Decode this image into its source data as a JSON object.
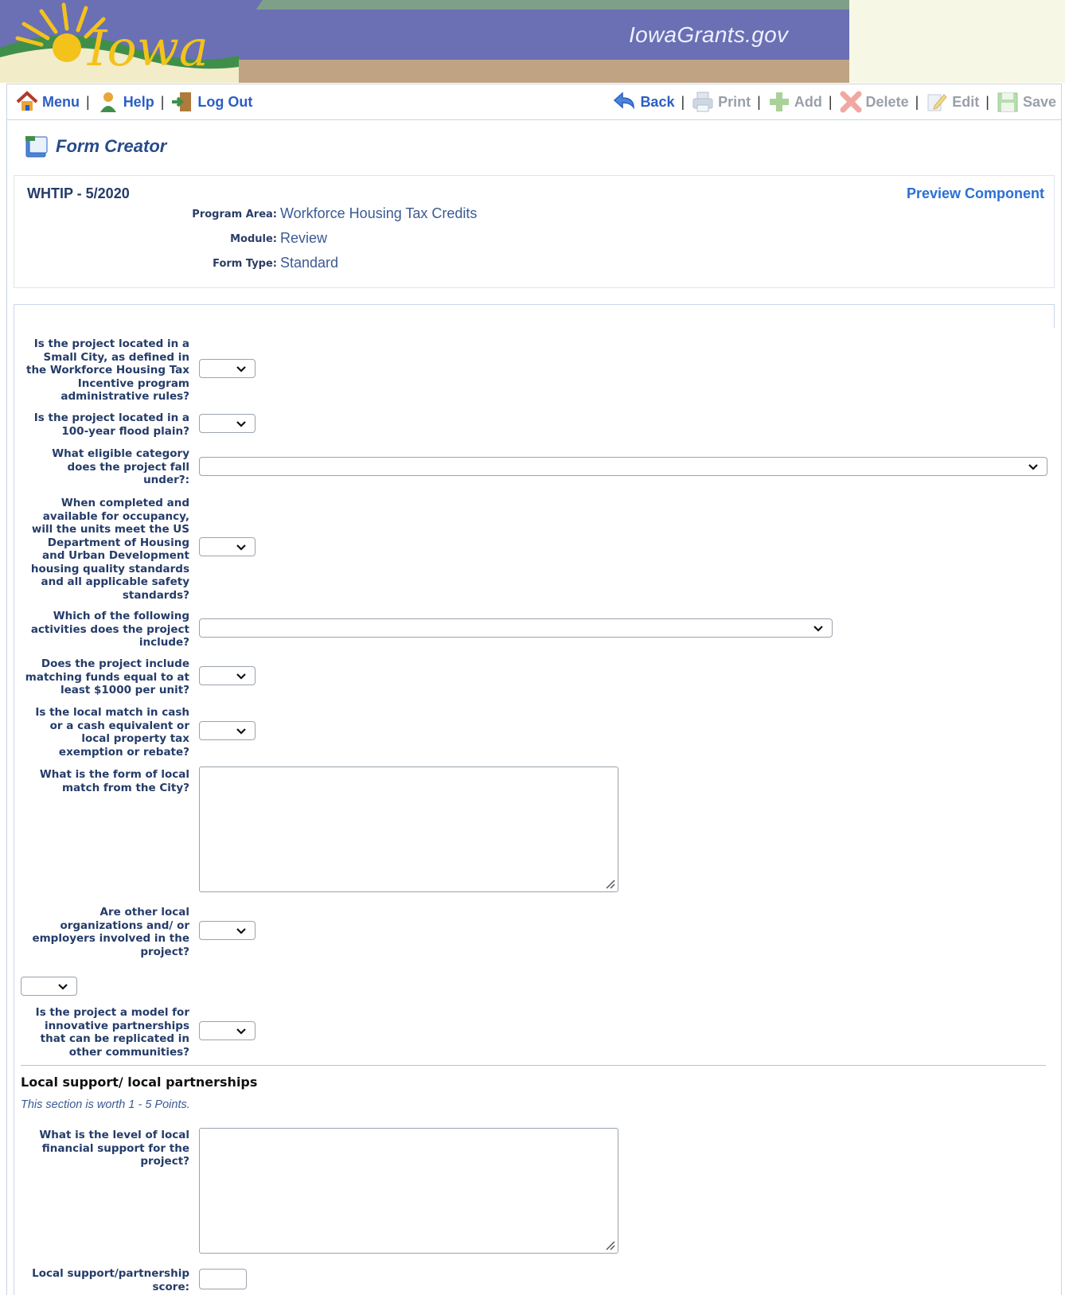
{
  "banner": {
    "site_name": "IowaGrants.gov",
    "logo_text": "Iowa"
  },
  "toolbar": {
    "menu": "Menu",
    "help": "Help",
    "logout": "Log Out",
    "back": "Back",
    "print": "Print",
    "add": "Add",
    "delete": "Delete",
    "edit": "Edit",
    "save": "Save",
    "separator": "|"
  },
  "page": {
    "title": "Form Creator"
  },
  "header": {
    "title": "WHTIP - 5/2020",
    "preview_link": "Preview Component",
    "program_area_label": "Program Area:",
    "program_area_value": "Workforce Housing Tax Credits",
    "module_label": "Module:",
    "module_value": "Review",
    "form_type_label": "Form Type:",
    "form_type_value": "Standard"
  },
  "questions": {
    "q1": "Is the project located in a Small City, as defined in the Workforce Housing Tax Incentive program administrative rules?",
    "q2": "Is the project located in a 100-year flood plain?",
    "q3": "What eligible category does the project fall under?:",
    "q4": "When completed and available for occupancy, will the units meet the US Department of Housing and Urban Development housing quality standards and all applicable safety standards?",
    "q5": "Which of the following activities does the project include?",
    "q6": "Does the project include matching funds equal to at least $1000 per unit?",
    "q7": "Is the local match in cash or a cash equivalent or local property tax exemption or rebate?",
    "q8": "What is the form of local match from the City?",
    "q9": "Are other local organizations and/ or employers involved in the project?",
    "q10": "Is the project a model for innovative partnerships that can be replicated in other communities?",
    "q11": "What is the level of local financial support for the project?",
    "q12": "Local support/partnership score:"
  },
  "section": {
    "heading": "Local support/ local partnerships",
    "note": "This section is worth 1 - 5 Points."
  },
  "colors": {
    "banner_purple": "#6a70b3",
    "banner_green": "#7fa088",
    "banner_tan": "#bfa382",
    "link_blue": "#2b5ec4",
    "label_navy": "#253c69"
  }
}
